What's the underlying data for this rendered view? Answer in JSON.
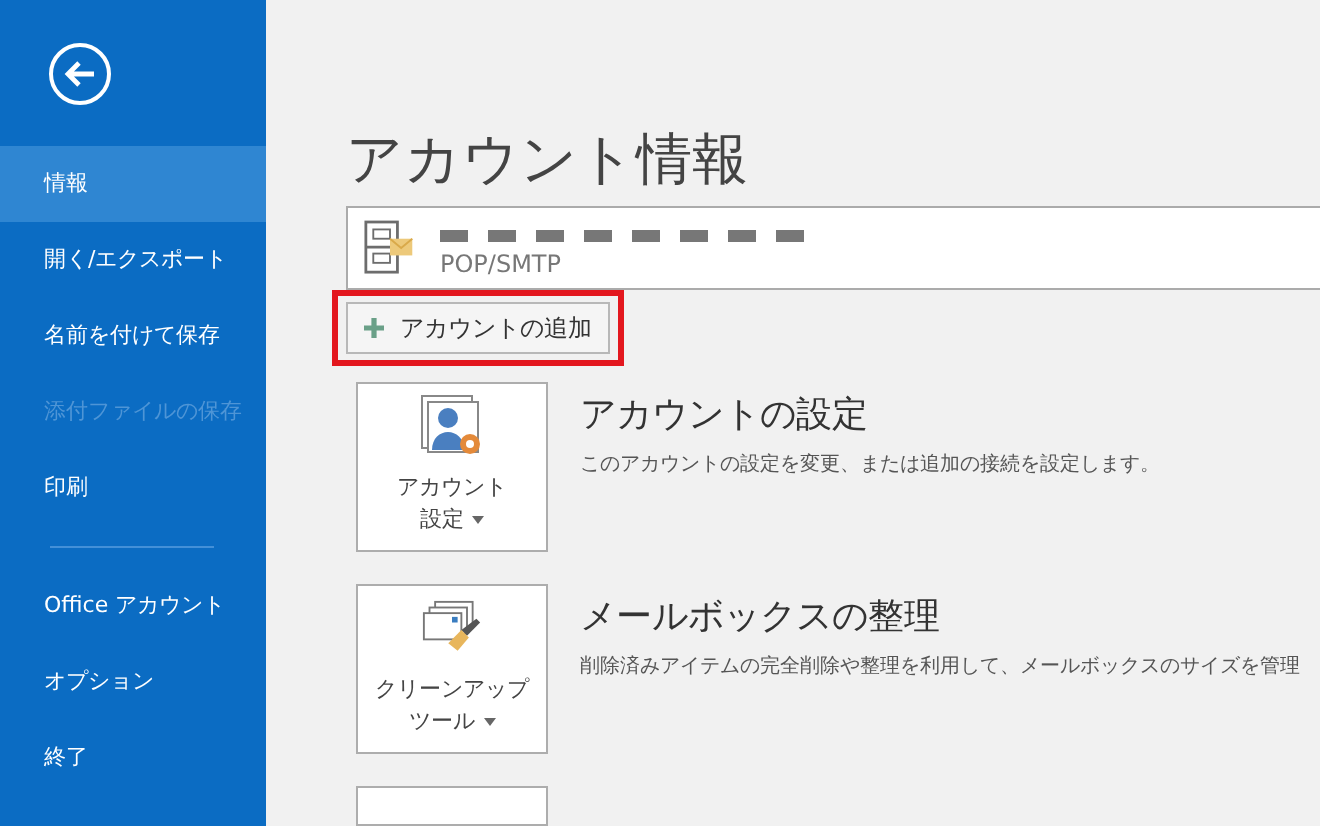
{
  "sidebar": {
    "items": [
      {
        "label": "情報",
        "selected": true,
        "disabled": false
      },
      {
        "label": "開く/エクスポート",
        "selected": false,
        "disabled": false
      },
      {
        "label": "名前を付けて保存",
        "selected": false,
        "disabled": false
      },
      {
        "label": "添付ファイルの保存",
        "selected": false,
        "disabled": true
      },
      {
        "label": "印刷",
        "selected": false,
        "disabled": false
      }
    ],
    "bottom_items": [
      {
        "label": "Office アカウント",
        "selected": false,
        "disabled": false
      },
      {
        "label": "オプション",
        "selected": false,
        "disabled": false
      },
      {
        "label": "終了",
        "selected": false,
        "disabled": false
      }
    ]
  },
  "page_title": "アカウント情報",
  "account": {
    "type": "POP/SMTP"
  },
  "add_account_button": {
    "label": "アカウントの追加",
    "highlighted": true
  },
  "sections": [
    {
      "kind": "account-settings",
      "button_lines": [
        "アカウント",
        "設定"
      ],
      "title": "アカウントの設定",
      "description": "このアカウントの設定を変更、または追加の接続を設定します。"
    },
    {
      "kind": "cleanup",
      "button_lines": [
        "クリーンアップ",
        "ツール"
      ],
      "title": "メールボックスの整理",
      "description": "削除済みアイテムの完全削除や整理を利用して、メールボックスのサイズを管理"
    }
  ]
}
